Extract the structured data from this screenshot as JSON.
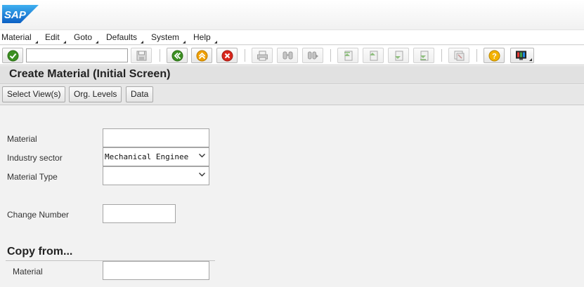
{
  "app": {
    "logo_text": "SAP"
  },
  "menu": [
    {
      "label": "Material"
    },
    {
      "label": "Edit"
    },
    {
      "label": "Goto"
    },
    {
      "label": "Defaults"
    },
    {
      "label": "System"
    },
    {
      "label": "Help"
    }
  ],
  "toolbar": {
    "command_field": {
      "value": "",
      "placeholder": ""
    },
    "icons": [
      "check-icon",
      "save-icon",
      "back-icon",
      "exit-icon",
      "cancel-icon",
      "print-icon",
      "find-icon",
      "find-next-icon",
      "first-page-icon",
      "previous-page-icon",
      "next-page-icon",
      "last-page-icon",
      "create-session-icon",
      "help-icon",
      "customize-layout-icon"
    ]
  },
  "page": {
    "title": "Create Material (Initial Screen)"
  },
  "app_toolbar": {
    "select_views": "Select View(s)",
    "org_levels": "Org. Levels",
    "data": "Data"
  },
  "form": {
    "material": {
      "label": "Material",
      "value": ""
    },
    "industry_sector": {
      "label": "Industry sector",
      "value": "Mechanical Enginee"
    },
    "material_type": {
      "label": "Material Type",
      "value": ""
    },
    "change_number": {
      "label": "Change Number",
      "value": ""
    }
  },
  "copy_from": {
    "title": "Copy from...",
    "material": {
      "label": "Material",
      "value": ""
    }
  },
  "colors": {
    "green": "#3c8f22",
    "orange": "#f0a000",
    "red": "#d9261c",
    "yellow": "#f3b200",
    "sap_blue": "#1a73d4"
  }
}
